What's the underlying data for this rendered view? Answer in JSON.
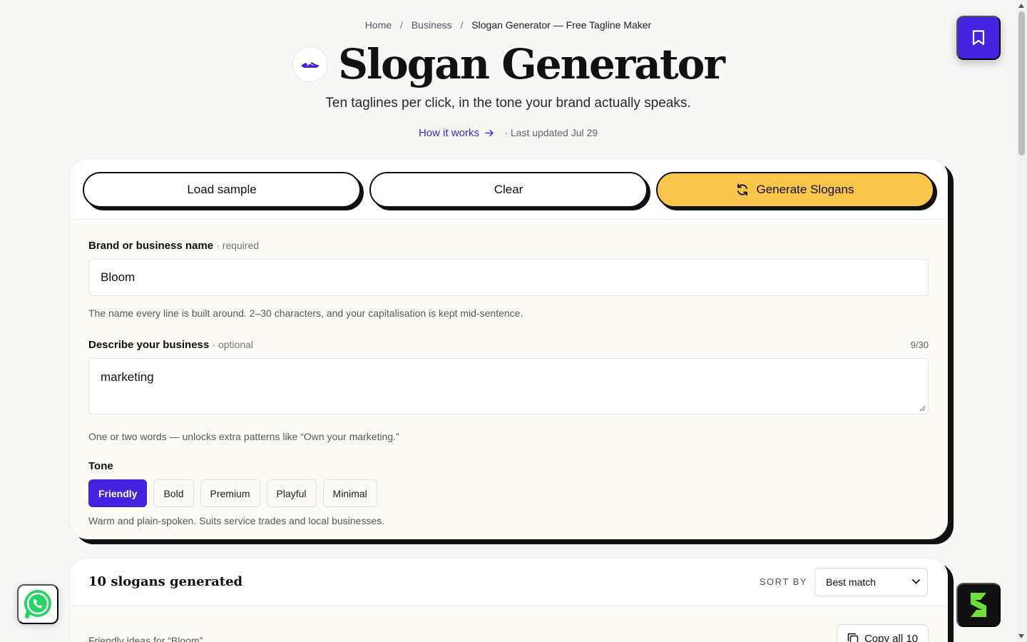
{
  "breadcrumb": {
    "items": [
      "Home",
      "Business"
    ],
    "current": "Slogan Generator — Free Tagline Maker",
    "separator": "/"
  },
  "header": {
    "title": "Slogan Generator",
    "subtitle": "Ten taglines per click, in the tone your brand actually speaks.",
    "how_link": "How it works",
    "updated": "· Last updated Jul 29"
  },
  "actions": {
    "load_sample": "Load sample",
    "clear": "Clear",
    "generate": "Generate Slogans"
  },
  "form": {
    "brand": {
      "label": "Brand or business name",
      "hint": "· required",
      "value": "Bloom",
      "help": "The name every line is built around. 2–30 characters, and your capitalisation is kept mid-sentence."
    },
    "describe": {
      "label": "Describe your business",
      "hint": "· optional",
      "counter": "9/30",
      "value": "marketing",
      "help": "One or two words — unlocks extra patterns like “Own your marketing.”"
    },
    "tone": {
      "label": "Tone",
      "options": [
        "Friendly",
        "Bold",
        "Premium",
        "Playful",
        "Minimal"
      ],
      "selected": "Friendly",
      "help": "Warm and plain-spoken. Suits service trades and local businesses."
    }
  },
  "results": {
    "title": "10 slogans generated",
    "sort_label": "SORT BY",
    "sort_value": "Best match",
    "subline": "Friendly ideas for “Bloom”",
    "copy_all": "Copy all 10"
  },
  "colors": {
    "accent": "#4422e0",
    "generate": "#f9c54a",
    "link": "#3a2fd8",
    "whatsapp": "#25d366",
    "s_badge": "#6fe03a"
  },
  "icons": {
    "bookmark": "bookmark-icon",
    "refresh": "refresh-icon",
    "arrow": "arrow-right-icon",
    "chevron": "chevron-down-icon",
    "copy": "copy-icon",
    "whatsapp": "whatsapp-icon",
    "s_logo": "s-logo-icon"
  }
}
